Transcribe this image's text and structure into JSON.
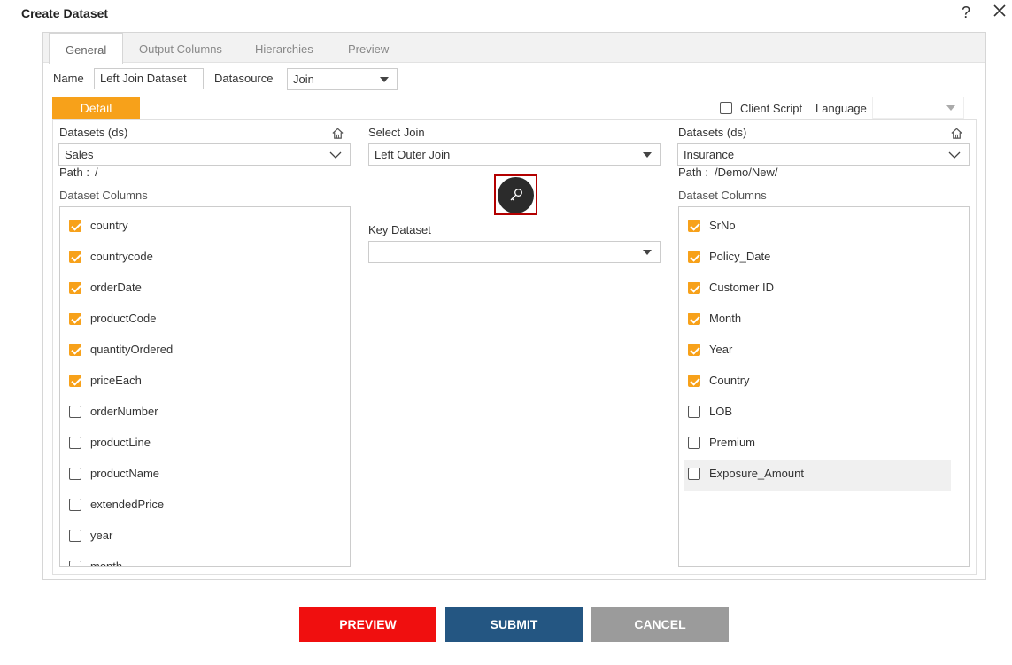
{
  "dialog": {
    "title": "Create Dataset",
    "help": "?"
  },
  "tabs": [
    "General",
    "Output Columns",
    "Hierarchies",
    "Preview"
  ],
  "general": {
    "name_label": "Name",
    "name_value": "Left Join Dataset",
    "datasource_label": "Datasource",
    "datasource_value": "Join",
    "detail_tab": "Detail",
    "client_script_label": "Client Script",
    "language_label": "Language",
    "language_value": ""
  },
  "left": {
    "datasets_label": "Datasets (ds)",
    "dataset_value": "Sales",
    "path_label": "Path :",
    "path_value": "/",
    "columns_label": "Dataset Columns",
    "columns": [
      {
        "name": "country",
        "checked": true
      },
      {
        "name": "countrycode",
        "checked": true
      },
      {
        "name": "orderDate",
        "checked": true
      },
      {
        "name": "productCode",
        "checked": true
      },
      {
        "name": "quantityOrdered",
        "checked": true
      },
      {
        "name": "priceEach",
        "checked": true
      },
      {
        "name": "orderNumber",
        "checked": false
      },
      {
        "name": "productLine",
        "checked": false
      },
      {
        "name": "productName",
        "checked": false
      },
      {
        "name": "extendedPrice",
        "checked": false
      },
      {
        "name": "year",
        "checked": false
      },
      {
        "name": "month",
        "checked": false
      }
    ]
  },
  "middle": {
    "select_join_label": "Select Join",
    "join_value": "Left Outer Join",
    "key_dataset_label": "Key Dataset",
    "key_dataset_value": ""
  },
  "right": {
    "datasets_label": "Datasets (ds)",
    "dataset_value": "Insurance",
    "path_label": "Path :",
    "path_value": "/Demo/New/",
    "columns_label": "Dataset Columns",
    "columns": [
      {
        "name": "SrNo",
        "checked": true
      },
      {
        "name": "Policy_Date",
        "checked": true
      },
      {
        "name": "Customer ID",
        "checked": true
      },
      {
        "name": "Month",
        "checked": true
      },
      {
        "name": "Year",
        "checked": true
      },
      {
        "name": "Country",
        "checked": true
      },
      {
        "name": "LOB",
        "checked": false
      },
      {
        "name": "Premium",
        "checked": false
      },
      {
        "name": "Exposure_Amount",
        "checked": false
      }
    ]
  },
  "footer": {
    "preview": "PREVIEW",
    "submit": "SUBMIT",
    "cancel": "CANCEL"
  },
  "colors": {
    "accent": "#f7a11a",
    "preview": "#f00f0f",
    "submit": "#245682",
    "cancel": "#9b9b9b",
    "highlight_border": "#b30000"
  }
}
